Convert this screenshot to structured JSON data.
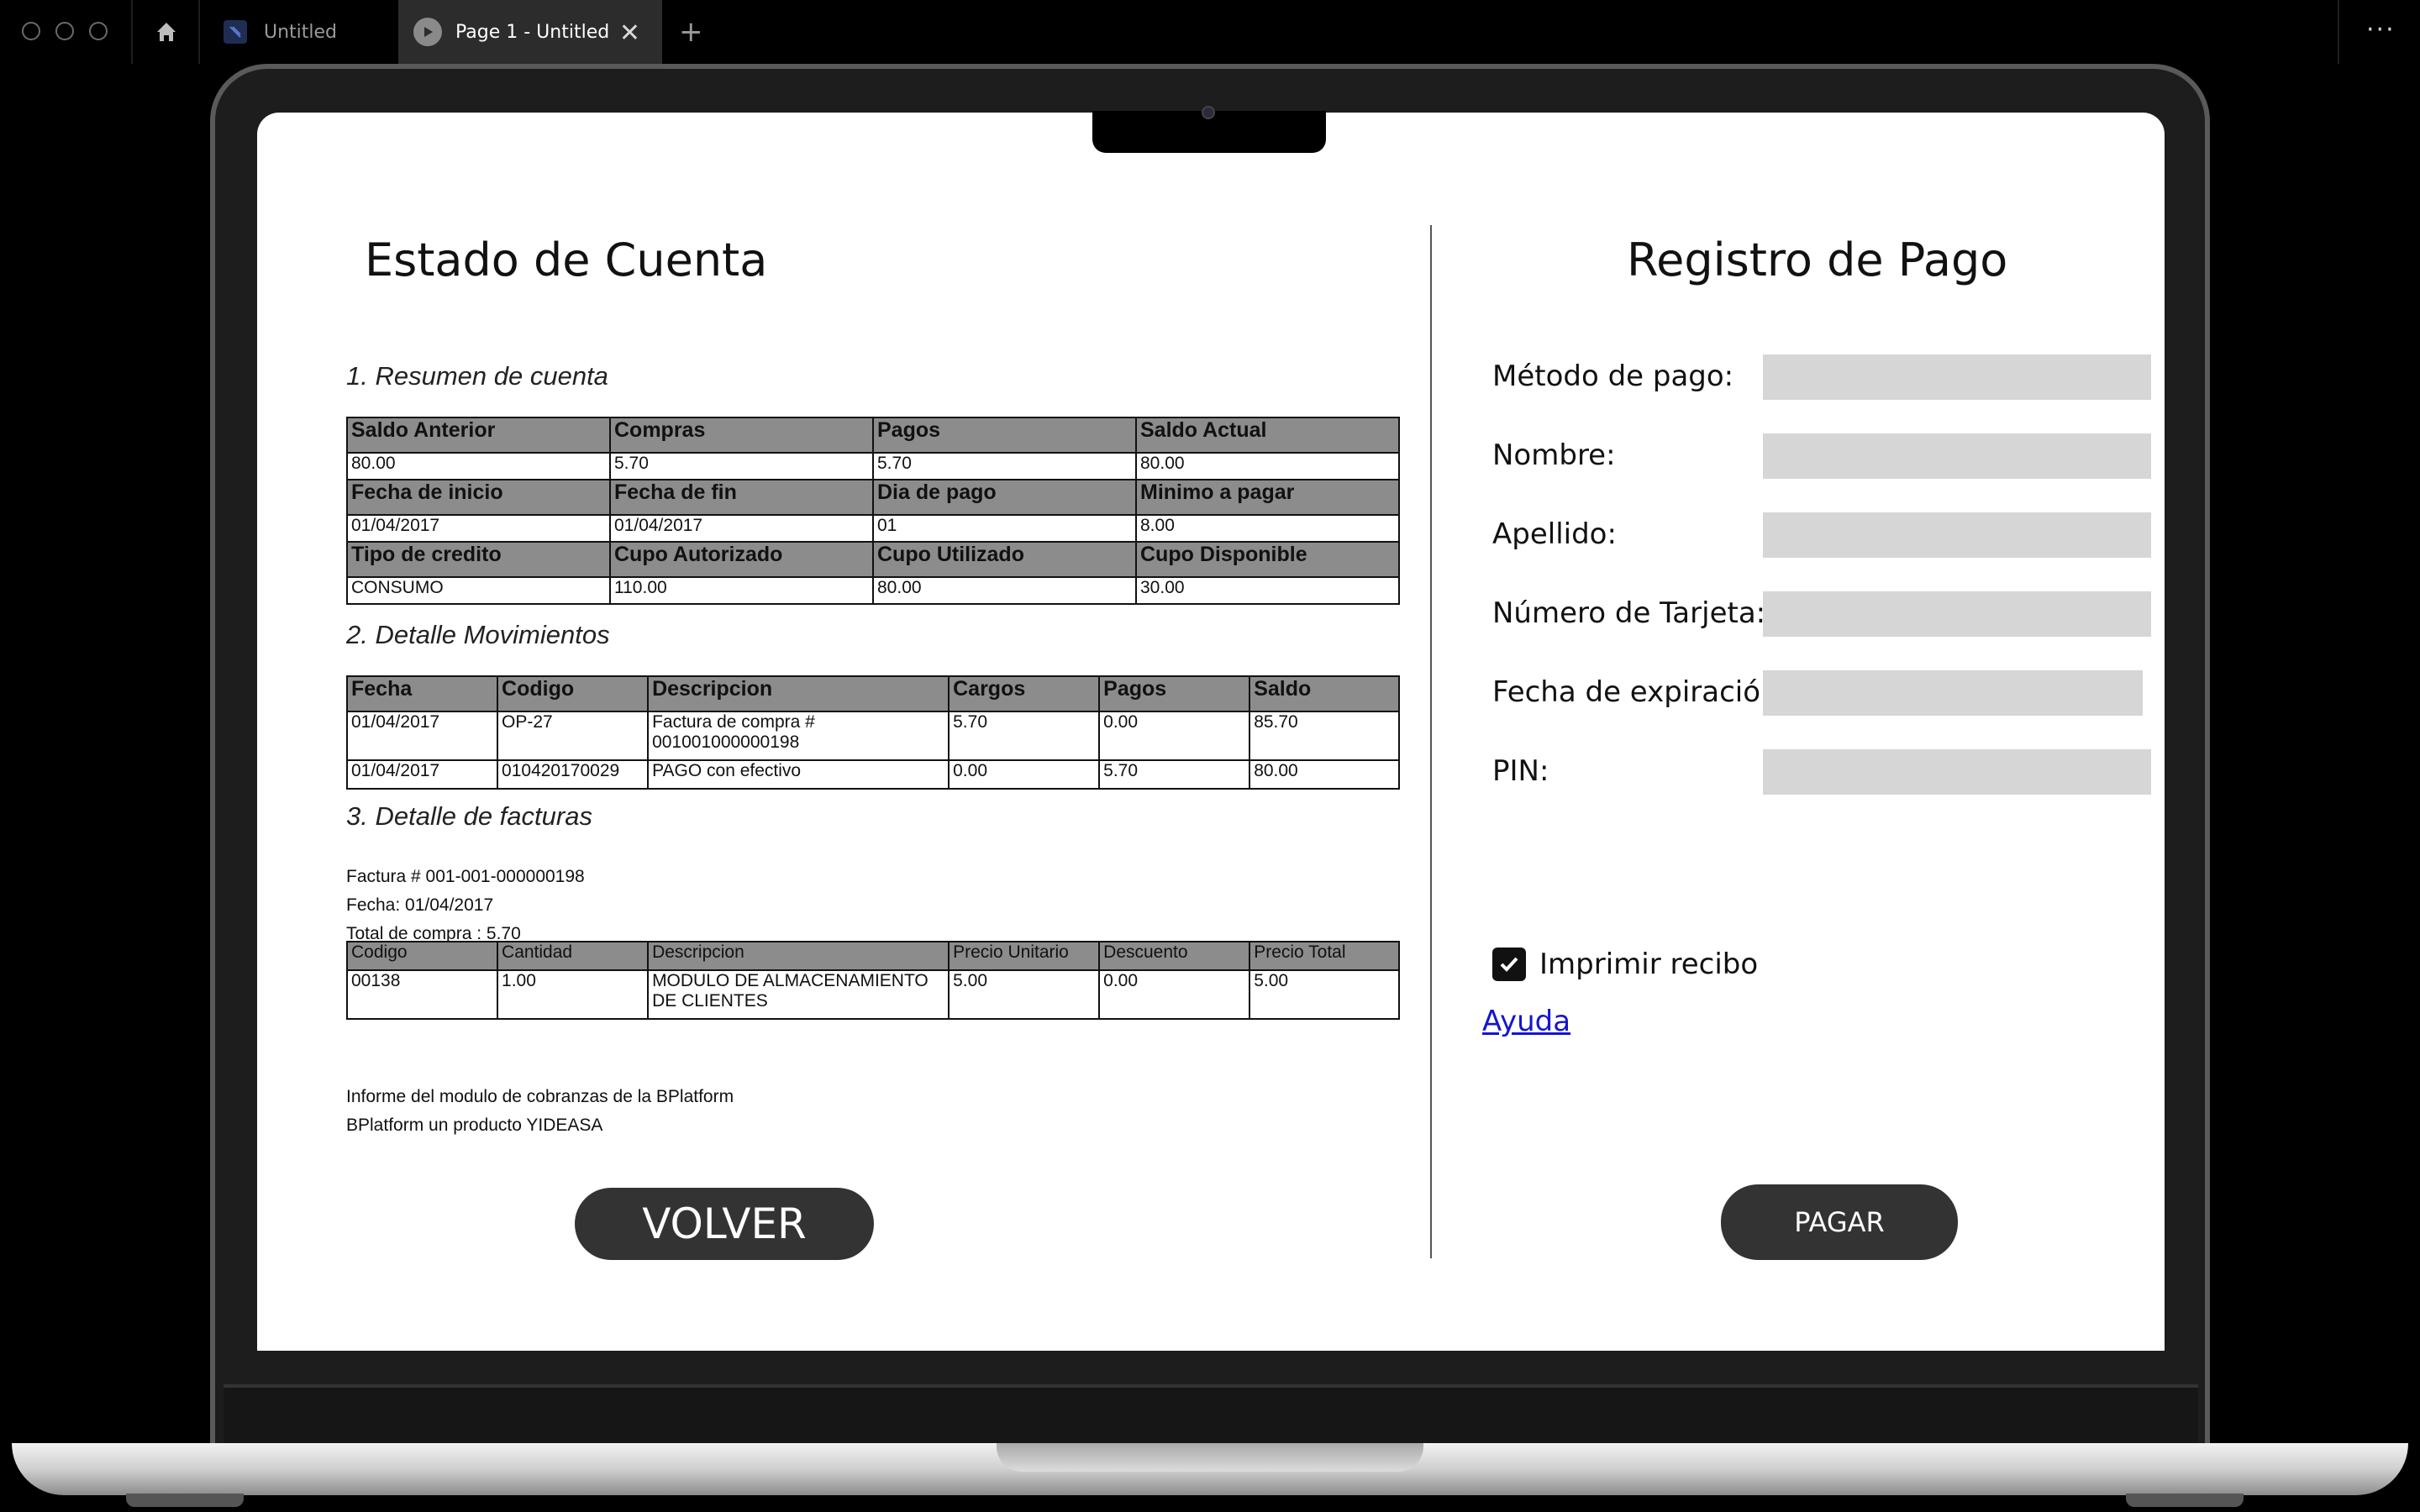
{
  "browser": {
    "tabs": [
      {
        "label": "Untitled"
      },
      {
        "label": "Page 1 - Untitled"
      }
    ],
    "close_glyph": "✕",
    "new_tab_glyph": "+",
    "more_glyph": "···",
    "icons": [
      "home-icon",
      "file-icon",
      "play-icon",
      "close-icon",
      "plus-icon",
      "more-icon"
    ]
  },
  "statement": {
    "title": "Estado de Cuenta",
    "section1": "1. Resumen de cuenta",
    "summary": [
      {
        "headers": [
          "Saldo Anterior",
          "Compras",
          "Pagos",
          "Saldo Actual"
        ],
        "values": [
          "80.00",
          "5.70",
          "5.70",
          "80.00"
        ]
      },
      {
        "headers": [
          "Fecha de inicio",
          "Fecha de fin",
          "Dia de pago",
          "Minimo a pagar"
        ],
        "values": [
          "01/04/2017",
          "01/04/2017",
          "01",
          "8.00"
        ]
      },
      {
        "headers": [
          "Tipo de credito",
          "Cupo Autorizado",
          "Cupo Utilizado",
          "Cupo Disponible"
        ],
        "values": [
          "CONSUMO",
          "110.00",
          "80.00",
          "30.00"
        ]
      }
    ],
    "section2": "2. Detalle Movimientos",
    "movements_headers": [
      "Fecha",
      "Codigo",
      "Descripcion",
      "Cargos",
      "Pagos",
      "Saldo"
    ],
    "movements": [
      [
        "01/04/2017",
        "OP-27",
        "Factura de compra # 001001000000198",
        "5.70",
        "0.00",
        "85.70"
      ],
      [
        "01/04/2017",
        "010420170029",
        "PAGO con efectivo",
        "0.00",
        "5.70",
        "80.00"
      ]
    ],
    "section3": "3. Detalle de facturas",
    "invoice_number": "Factura # 001-001-000000198",
    "invoice_date": "Fecha: 01/04/2017",
    "invoice_total": "Total de compra : 5.70",
    "invoice_headers": [
      "Codigo",
      "Cantidad",
      "Descripcion",
      "Precio Unitario",
      "Descuento",
      "Precio Total"
    ],
    "invoice_rows": [
      [
        "00138",
        "1.00",
        "MODULO DE ALMACENAMIENTO DE CLIENTES",
        "5.00",
        "0.00",
        "5.00"
      ]
    ],
    "footer_line1": "Informe del modulo de cobranzas de la BPlatform",
    "footer_line2": "BPlatform un producto YIDEASA",
    "back_label": "VOLVER"
  },
  "payment": {
    "title": "Registro de Pago",
    "fields": [
      {
        "label": "Método de pago:",
        "value": ""
      },
      {
        "label": "Nombre:",
        "value": ""
      },
      {
        "label": "Apellido:",
        "value": ""
      },
      {
        "label": "Número de Tarjeta:",
        "value": ""
      },
      {
        "label": "Fecha de expiración:",
        "value": ""
      },
      {
        "label": "PIN:",
        "value": ""
      }
    ],
    "print_receipt_label": "Imprimir recibo",
    "print_receipt_checked": true,
    "help_label": "Ayuda",
    "pay_label": "PAGAR"
  }
}
